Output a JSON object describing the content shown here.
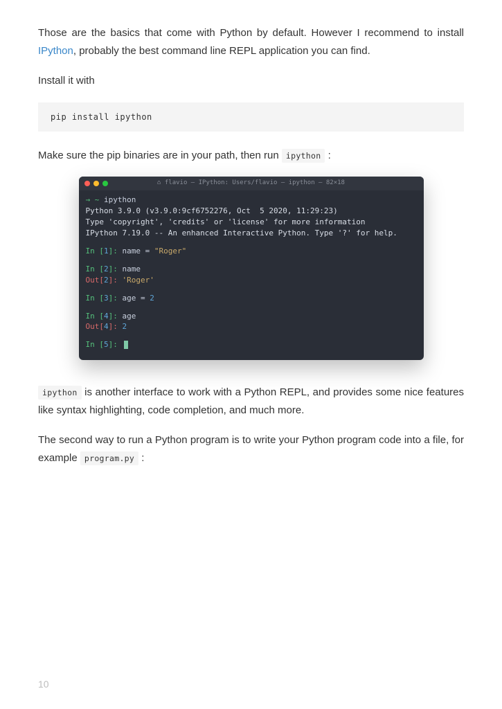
{
  "para1_a": "Those are the basics that come with Python by default. However I recommend to install ",
  "para1_link": "IPython",
  "para1_b": ", probably the best command line REPL application you can find.",
  "para2": "Install it with",
  "code1": "pip install ipython",
  "para3_a": "Make sure the pip binaries are in your path, then run ",
  "para3_code": "ipython",
  "para3_b": " :",
  "terminal": {
    "title": "⌂ flavio — IPython: Users/flavio — ipython — 82×18",
    "prompt_arrow": "→",
    "prompt_tilde": " ~ ",
    "cmd": "ipython",
    "line1": "Python 3.9.0 (v3.9.0:9cf6752276, Oct  5 2020, 11:29:23)",
    "line2": "Type 'copyright', 'credits' or 'license' for more information",
    "line3": "IPython 7.19.0 -- An enhanced Interactive Python. Type '?' for help.",
    "in1_label": "In [",
    "in1_n": "1",
    "in1_close": "]: ",
    "in1_code_a": "name ",
    "in1_code_eq": "= ",
    "in1_code_str": "\"Roger\"",
    "in2_n": "2",
    "in2_code": "name",
    "out2_label": "Out[",
    "out2_n": "2",
    "out2_close": "]: ",
    "out2_val": "'Roger'",
    "in3_n": "3",
    "in3_code_a": "age ",
    "in3_code_eq": "= ",
    "in3_code_num": "2",
    "in4_n": "4",
    "in4_code": "age",
    "out4_n": "4",
    "out4_val": "2",
    "in5_n": "5"
  },
  "para4_code": "ipython",
  "para4_rest": " is another interface to work with a Python REPL, and provides some nice features like syntax highlighting, code completion, and much more.",
  "para5_a": "The second way to run a Python program is to write your Python program code into a file, for example ",
  "para5_code": "program.py",
  "para5_b": " :",
  "page_number": "10"
}
